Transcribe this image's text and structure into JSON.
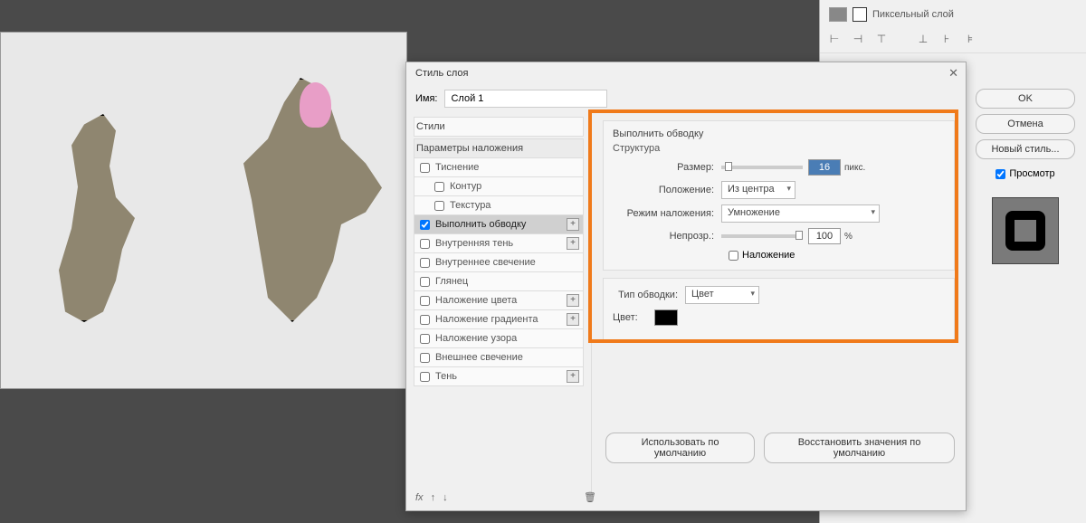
{
  "dialog": {
    "title": "Стиль слоя",
    "close": "✕",
    "name_label": "Имя:",
    "name_value": "Слой 1"
  },
  "styles": {
    "header": "Стили",
    "subheader": "Параметры наложения",
    "items": [
      {
        "label": "Тиснение",
        "checked": false,
        "indent": false,
        "plus": false
      },
      {
        "label": "Контур",
        "checked": false,
        "indent": true,
        "plus": false
      },
      {
        "label": "Текстура",
        "checked": false,
        "indent": true,
        "plus": false
      },
      {
        "label": "Выполнить обводку",
        "checked": true,
        "indent": false,
        "plus": true,
        "selected": true
      },
      {
        "label": "Внутренняя тень",
        "checked": false,
        "indent": false,
        "plus": true
      },
      {
        "label": "Внутреннее свечение",
        "checked": false,
        "indent": false,
        "plus": false
      },
      {
        "label": "Глянец",
        "checked": false,
        "indent": false,
        "plus": false
      },
      {
        "label": "Наложение цвета",
        "checked": false,
        "indent": false,
        "plus": true
      },
      {
        "label": "Наложение градиента",
        "checked": false,
        "indent": false,
        "plus": true
      },
      {
        "label": "Наложение узора",
        "checked": false,
        "indent": false,
        "plus": false
      },
      {
        "label": "Внешнее свечение",
        "checked": false,
        "indent": false,
        "plus": false
      },
      {
        "label": "Тень",
        "checked": false,
        "indent": false,
        "plus": true
      }
    ]
  },
  "stroke": {
    "title": "Выполнить обводку",
    "structure": "Структура",
    "size_label": "Размер:",
    "size_value": "16",
    "size_unit": "пикс.",
    "position_label": "Положение:",
    "position_value": "Из центра",
    "blend_label": "Режим наложения:",
    "blend_value": "Умножение",
    "opacity_label": "Непрозр.:",
    "opacity_value": "100",
    "opacity_unit": "%",
    "overlay_label": "Наложение",
    "type_label": "Тип обводки:",
    "type_value": "Цвет",
    "color_label": "Цвет:",
    "color_value": "#000000"
  },
  "buttons": {
    "default": "Использовать по умолчанию",
    "reset": "Восстановить значения по умолчанию",
    "ok": "OK",
    "cancel": "Отмена",
    "new_style": "Новый стиль...",
    "preview": "Просмотр"
  },
  "footer": {
    "fx": "fx",
    "up": "↑",
    "down": "↓",
    "trash": "🗑"
  },
  "layer_panel": {
    "layer_name": "Пиксельный слой"
  },
  "align_icons": [
    "⫱",
    "⫲",
    "⫳",
    "",
    "⫴",
    "⫵",
    "⫶"
  ]
}
